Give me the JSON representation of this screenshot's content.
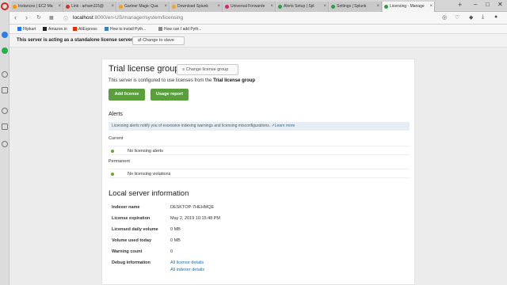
{
  "browser": {
    "tabs": [
      {
        "label": "Instances | EC2 Ma",
        "color": "#f79400"
      },
      {
        "label": "Link - arham115@",
        "color": "#d93025"
      },
      {
        "label": "Gartner Magic Qua",
        "color": "#f0a030"
      },
      {
        "label": "Download Splunk",
        "color": "#f5a623"
      },
      {
        "label": "Universal Forwarde",
        "color": "#d6246e"
      },
      {
        "label": "Alerts Setup | Spl",
        "color": "#2e9d45"
      },
      {
        "label": "Settings | Splunk",
        "color": "#2e9d45"
      },
      {
        "label": "Licensing - Manage",
        "color": "#2e9d45"
      }
    ],
    "new_tab": "+",
    "window_controls": {
      "minimize": "–",
      "maximize": "□",
      "close": "✕"
    },
    "url_host": "localhost",
    "url_path": ":8000/en-US/manager/system/licensing",
    "bookmarks": [
      {
        "label": "Flipkart",
        "color": "#2874f0"
      },
      {
        "label": "Amazon.in",
        "color": "#222222"
      },
      {
        "label": "AliExpress",
        "color": "#e62e04"
      },
      {
        "label": "How to install Pyth...",
        "color": "#3c7ebf"
      },
      {
        "label": "How can I add Pyth...",
        "color": "#888888"
      }
    ]
  },
  "standalone": {
    "message": "This server is acting as a standalone license server",
    "button": "Change to slave"
  },
  "page": {
    "title": "Trial license group",
    "change_group": "Change license group",
    "description_prefix": "This server is configured to use licenses from the",
    "description_group": "Trial license group",
    "add_license": "Add license",
    "usage_report": "Usage report",
    "alerts_heading": "Alerts",
    "alerts_info": "Licensing alerts notify you of excessive indexing warnings and licensing misconfigurations.",
    "learn_more": "Learn more",
    "current_label": "Current",
    "current_text": "No licensing alerts",
    "permanent_label": "Permanent",
    "permanent_text": "No licensing violations",
    "local_heading": "Local server information",
    "info_rows": [
      {
        "key": "Indexer name",
        "value": "DESKTOP-7HEHMQE"
      },
      {
        "key": "License expiration",
        "value": "May 2, 2019 10:15:48 PM"
      },
      {
        "key": "Licensed daily volume",
        "value": "0 MB"
      },
      {
        "key": "Volume used today",
        "value": "0 MB"
      },
      {
        "key": "Warning count",
        "value": "0"
      },
      {
        "key": "Debug information",
        "value": "All license details"
      },
      {
        "key": "",
        "value": "All indexer details"
      }
    ]
  },
  "colors": {
    "green_button": "#5a9e3d",
    "link": "#1a6fb0",
    "status_dot": "#65a637",
    "opera_red": "#d3281f"
  }
}
